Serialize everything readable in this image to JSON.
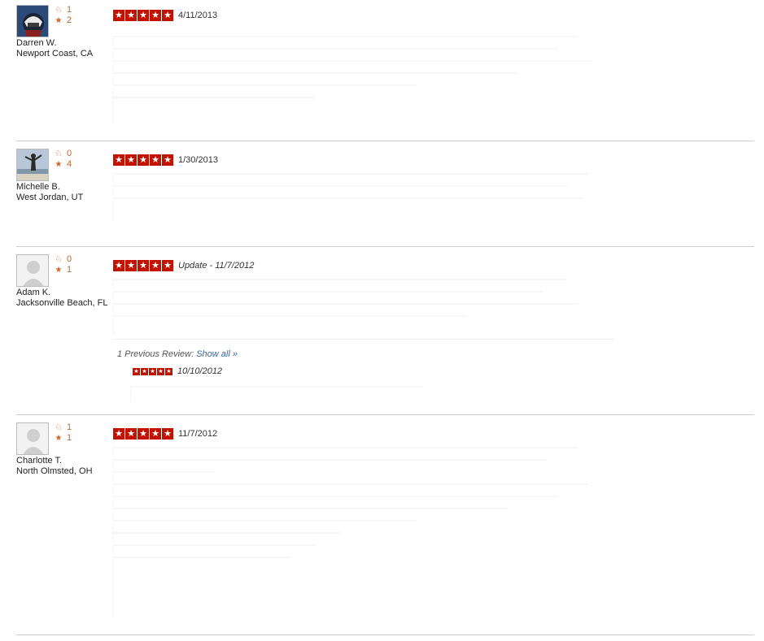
{
  "reviews": [
    {
      "name": "Darren W.",
      "location": "Newport Coast, CA",
      "friends": "1",
      "review_count": "2",
      "avatar_type": "photo-helmet",
      "rating_stars": 5,
      "date": "4/11/2013"
    },
    {
      "name": "Michelle B.",
      "location": "West Jordan, UT",
      "friends": "0",
      "review_count": "4",
      "avatar_type": "photo-beach",
      "rating_stars": 5,
      "date": "1/30/2013"
    },
    {
      "name": "Adam K.",
      "location": "Jacksonville Beach, FL",
      "friends": "0",
      "review_count": "1",
      "avatar_type": "default",
      "rating_stars": 5,
      "date": "Update - 11/7/2012",
      "previous": {
        "label": "1 Previous Review:",
        "link": "Show all »",
        "date": "10/10/2012",
        "rating_stars": 5
      }
    },
    {
      "name": "Charlotte T.",
      "location": "North Olmsted, OH",
      "friends": "1",
      "review_count": "1",
      "avatar_type": "default",
      "rating_stars": 5,
      "date": "11/7/2012"
    }
  ],
  "icons": {
    "friends": "friends-icon",
    "reviews": "star-icon"
  },
  "colors": {
    "star_bg": "#c41200",
    "stat_orange": "#c4662b",
    "link": "#3366aa",
    "divider": "#cfcfcf"
  }
}
